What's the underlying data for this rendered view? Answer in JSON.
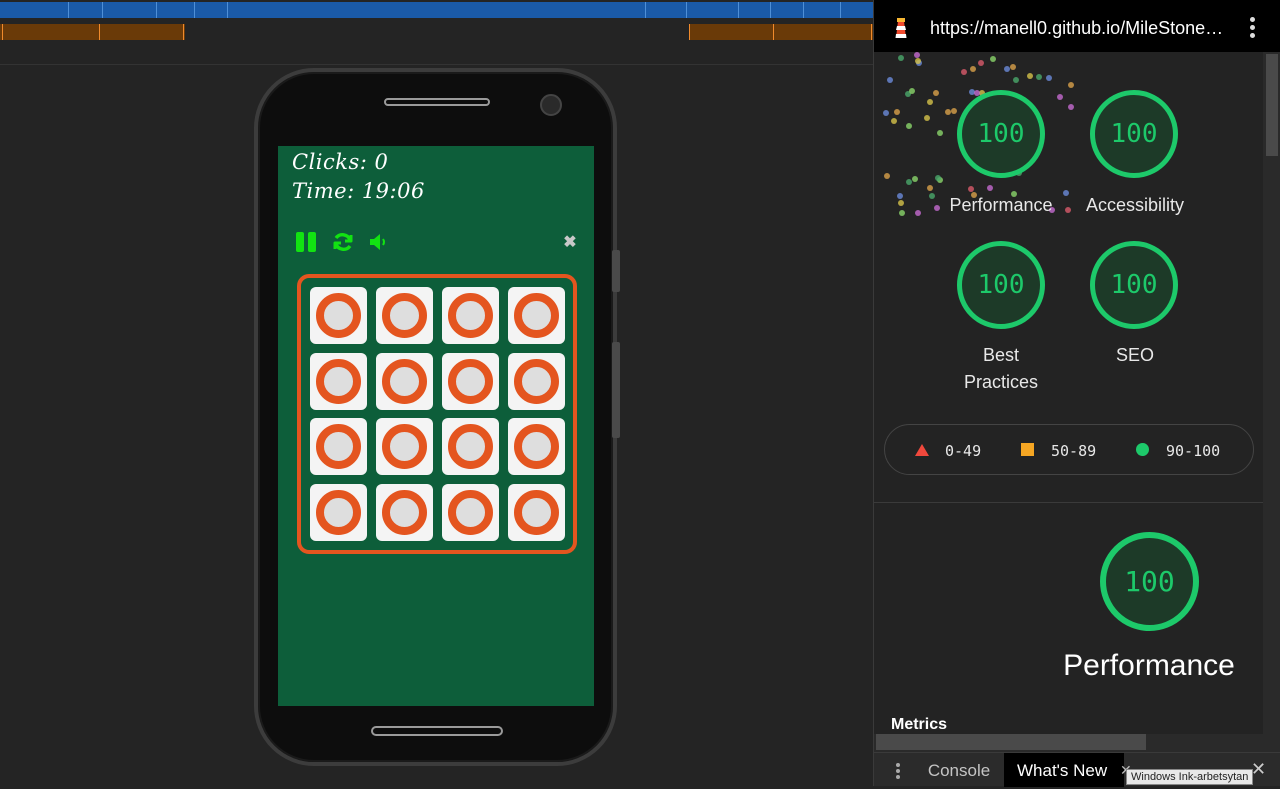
{
  "game": {
    "clicks_label": "Clicks: 0",
    "time_label": "Time: 19:06",
    "close_glyph": "✖",
    "card_count": 16
  },
  "devtools": {
    "url": "https://manell0.github.io/MileStone…",
    "scores": [
      {
        "value": "100",
        "label": "Performance"
      },
      {
        "value": "100",
        "label": "Accessibility"
      },
      {
        "value": "100",
        "label": "Best Practices"
      },
      {
        "value": "100",
        "label": "SEO"
      }
    ],
    "legend": {
      "fail": "0-49",
      "average": "50-89",
      "pass": "90-100"
    },
    "section": {
      "score": "100",
      "title": "Performance",
      "metrics_heading": "Metrics"
    },
    "drawer": {
      "console_tab": "Console",
      "whats_new_tab": "What's New",
      "close_glyph": "✕",
      "tooltip": "Windows Ink-arbetsytan"
    }
  },
  "colors": {
    "pass_green": "#1dc96a",
    "game_bg": "#0d5e3a",
    "card_ring": "#e4551f",
    "control_green": "#12e212"
  },
  "icons": [
    "lighthouse-icon",
    "more-vert-icon",
    "pause-icon",
    "restart-icon",
    "volume-icon",
    "close-icon"
  ]
}
